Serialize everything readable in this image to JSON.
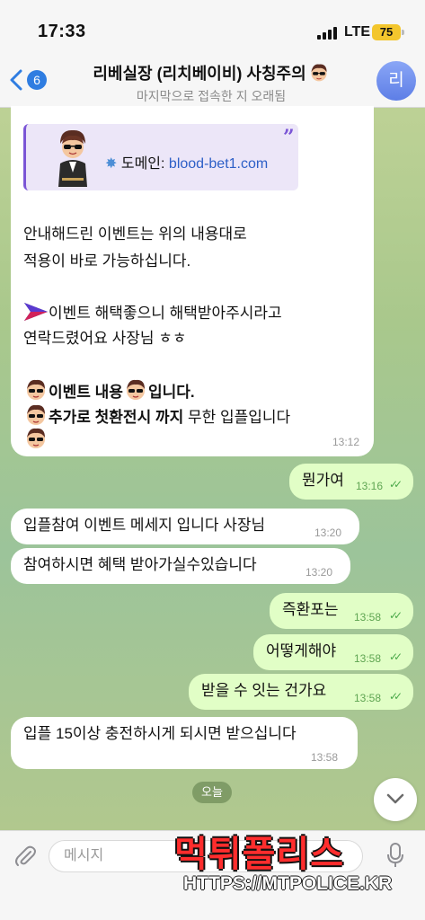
{
  "status_bar": {
    "time": "17:33",
    "network": "LTE",
    "battery": "75"
  },
  "header": {
    "back_badge": "6",
    "title": "리베실장 (리치베이비) 사칭주의",
    "subtitle": "마지막으로 접속한 지 오래됨",
    "avatar_letter": "리"
  },
  "messages": {
    "m1": {
      "card_prefix": "도메인: ",
      "card_domain": "blood-bet1.com",
      "line1": "안내해드린 이벤트는 위의 내용대로",
      "line2": "적용이 바로 가능하십니다.",
      "line3": "이벤트 해택좋으니 해택받아주시라고",
      "line4": "연락드렸어요 사장님 ㅎㅎ",
      "line5_bold": "이벤트 내용",
      "line5_tail": "입니다.",
      "line6_bold": "추가로  첫환전시  까지",
      "line6_tail": " 무한 입플입니다",
      "time": "13:12"
    },
    "m2": {
      "text": "뭔가여",
      "time": "13:16"
    },
    "m3": {
      "text": "입플참여 이벤트 메세지 입니다 사장님",
      "time": "13:20"
    },
    "m4": {
      "text": "참여하시면 혜택 받아가실수있습니다",
      "time": "13:20"
    },
    "m5": {
      "text": "즉환포는",
      "time": "13:58"
    },
    "m6": {
      "text": "어떻게해야",
      "time": "13:58"
    },
    "m7": {
      "text": "받을 수 잇는 건가요",
      "time": "13:58"
    },
    "m8": {
      "text": "입플 15이상 충전하시게 되시면 받으십니다",
      "time": "13:58"
    }
  },
  "date_chip": "오늘",
  "input": {
    "placeholder": "메시지"
  },
  "watermark": {
    "title": "먹튀폴리스",
    "url": "HTTPS://MTPOLICE.KR"
  },
  "colors": {
    "accent": "#2f7de1",
    "out_bubble": "#e1fec6",
    "ticks": "#4ba94a",
    "watermark_red": "#ff2d2d"
  }
}
